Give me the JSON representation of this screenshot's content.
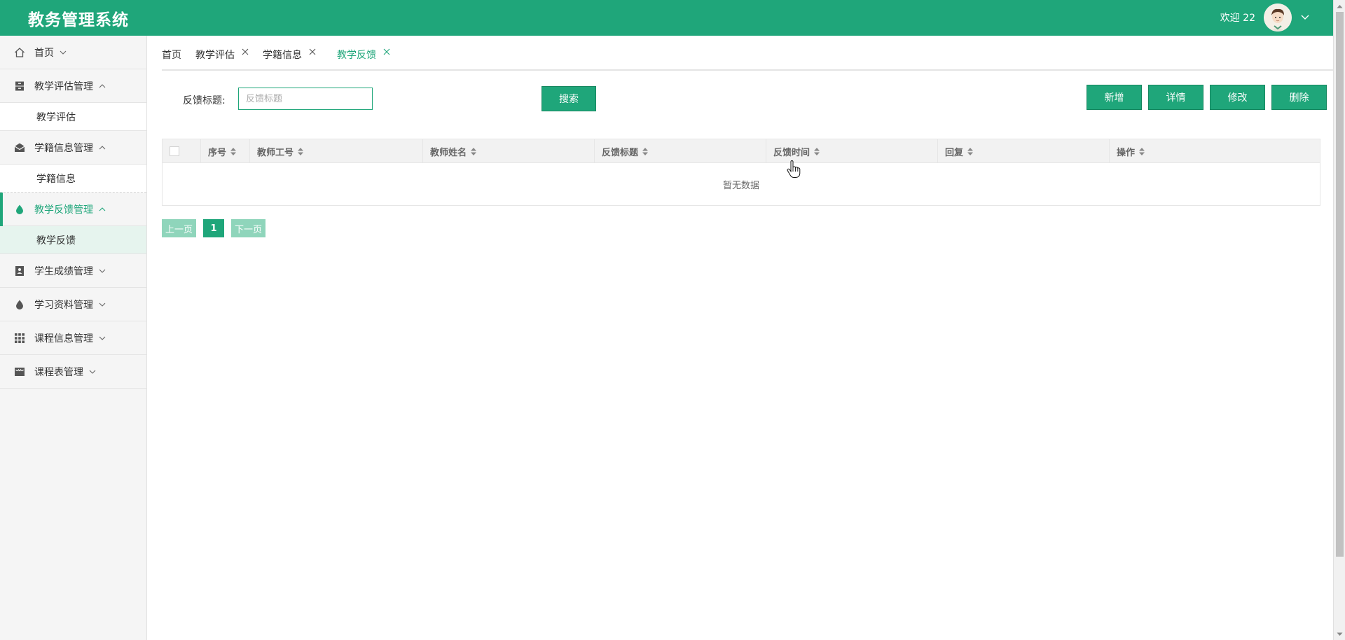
{
  "app": {
    "title": "教务管理系统"
  },
  "user": {
    "welcome": "欢迎 22"
  },
  "colors": {
    "brand": "#1fa67a",
    "brand_light": "#8fd5bb",
    "active_bg": "#e6f4ee"
  },
  "sidebar": {
    "items": [
      {
        "label": "首页",
        "icon": "home-icon",
        "expanded": false
      },
      {
        "label": "教学评估管理",
        "icon": "archive-icon",
        "expanded": true,
        "children": [
          "教学评估"
        ]
      },
      {
        "label": "学籍信息管理",
        "icon": "envelope-icon",
        "expanded": true,
        "children": [
          "学籍信息"
        ]
      },
      {
        "label": "教学反馈管理",
        "icon": "droplet-icon",
        "expanded": true,
        "active": true,
        "children": [
          "教学反馈"
        ]
      },
      {
        "label": "学生成绩管理",
        "icon": "contact-book-icon",
        "expanded": false
      },
      {
        "label": "学习资料管理",
        "icon": "droplet-icon",
        "expanded": false
      },
      {
        "label": "课程信息管理",
        "icon": "grid-icon",
        "expanded": false
      },
      {
        "label": "课程表管理",
        "icon": "store-icon",
        "expanded": false
      }
    ]
  },
  "tabs": [
    {
      "label": "首页",
      "closable": false
    },
    {
      "label": "教学评估",
      "closable": true
    },
    {
      "label": "学籍信息",
      "closable": true
    },
    {
      "label": "教学反馈",
      "closable": true,
      "active": true
    }
  ],
  "search": {
    "label": "反馈标题:",
    "placeholder": "反馈标题",
    "button": "搜索"
  },
  "actions": {
    "add": "新增",
    "detail": "详情",
    "edit": "修改",
    "delete": "删除"
  },
  "table": {
    "columns": [
      "序号",
      "教师工号",
      "教师姓名",
      "反馈标题",
      "反馈时间",
      "回复",
      "操作"
    ],
    "empty_text": "暂无数据"
  },
  "pager": {
    "prev": "上一页",
    "current": "1",
    "next": "下一页"
  }
}
